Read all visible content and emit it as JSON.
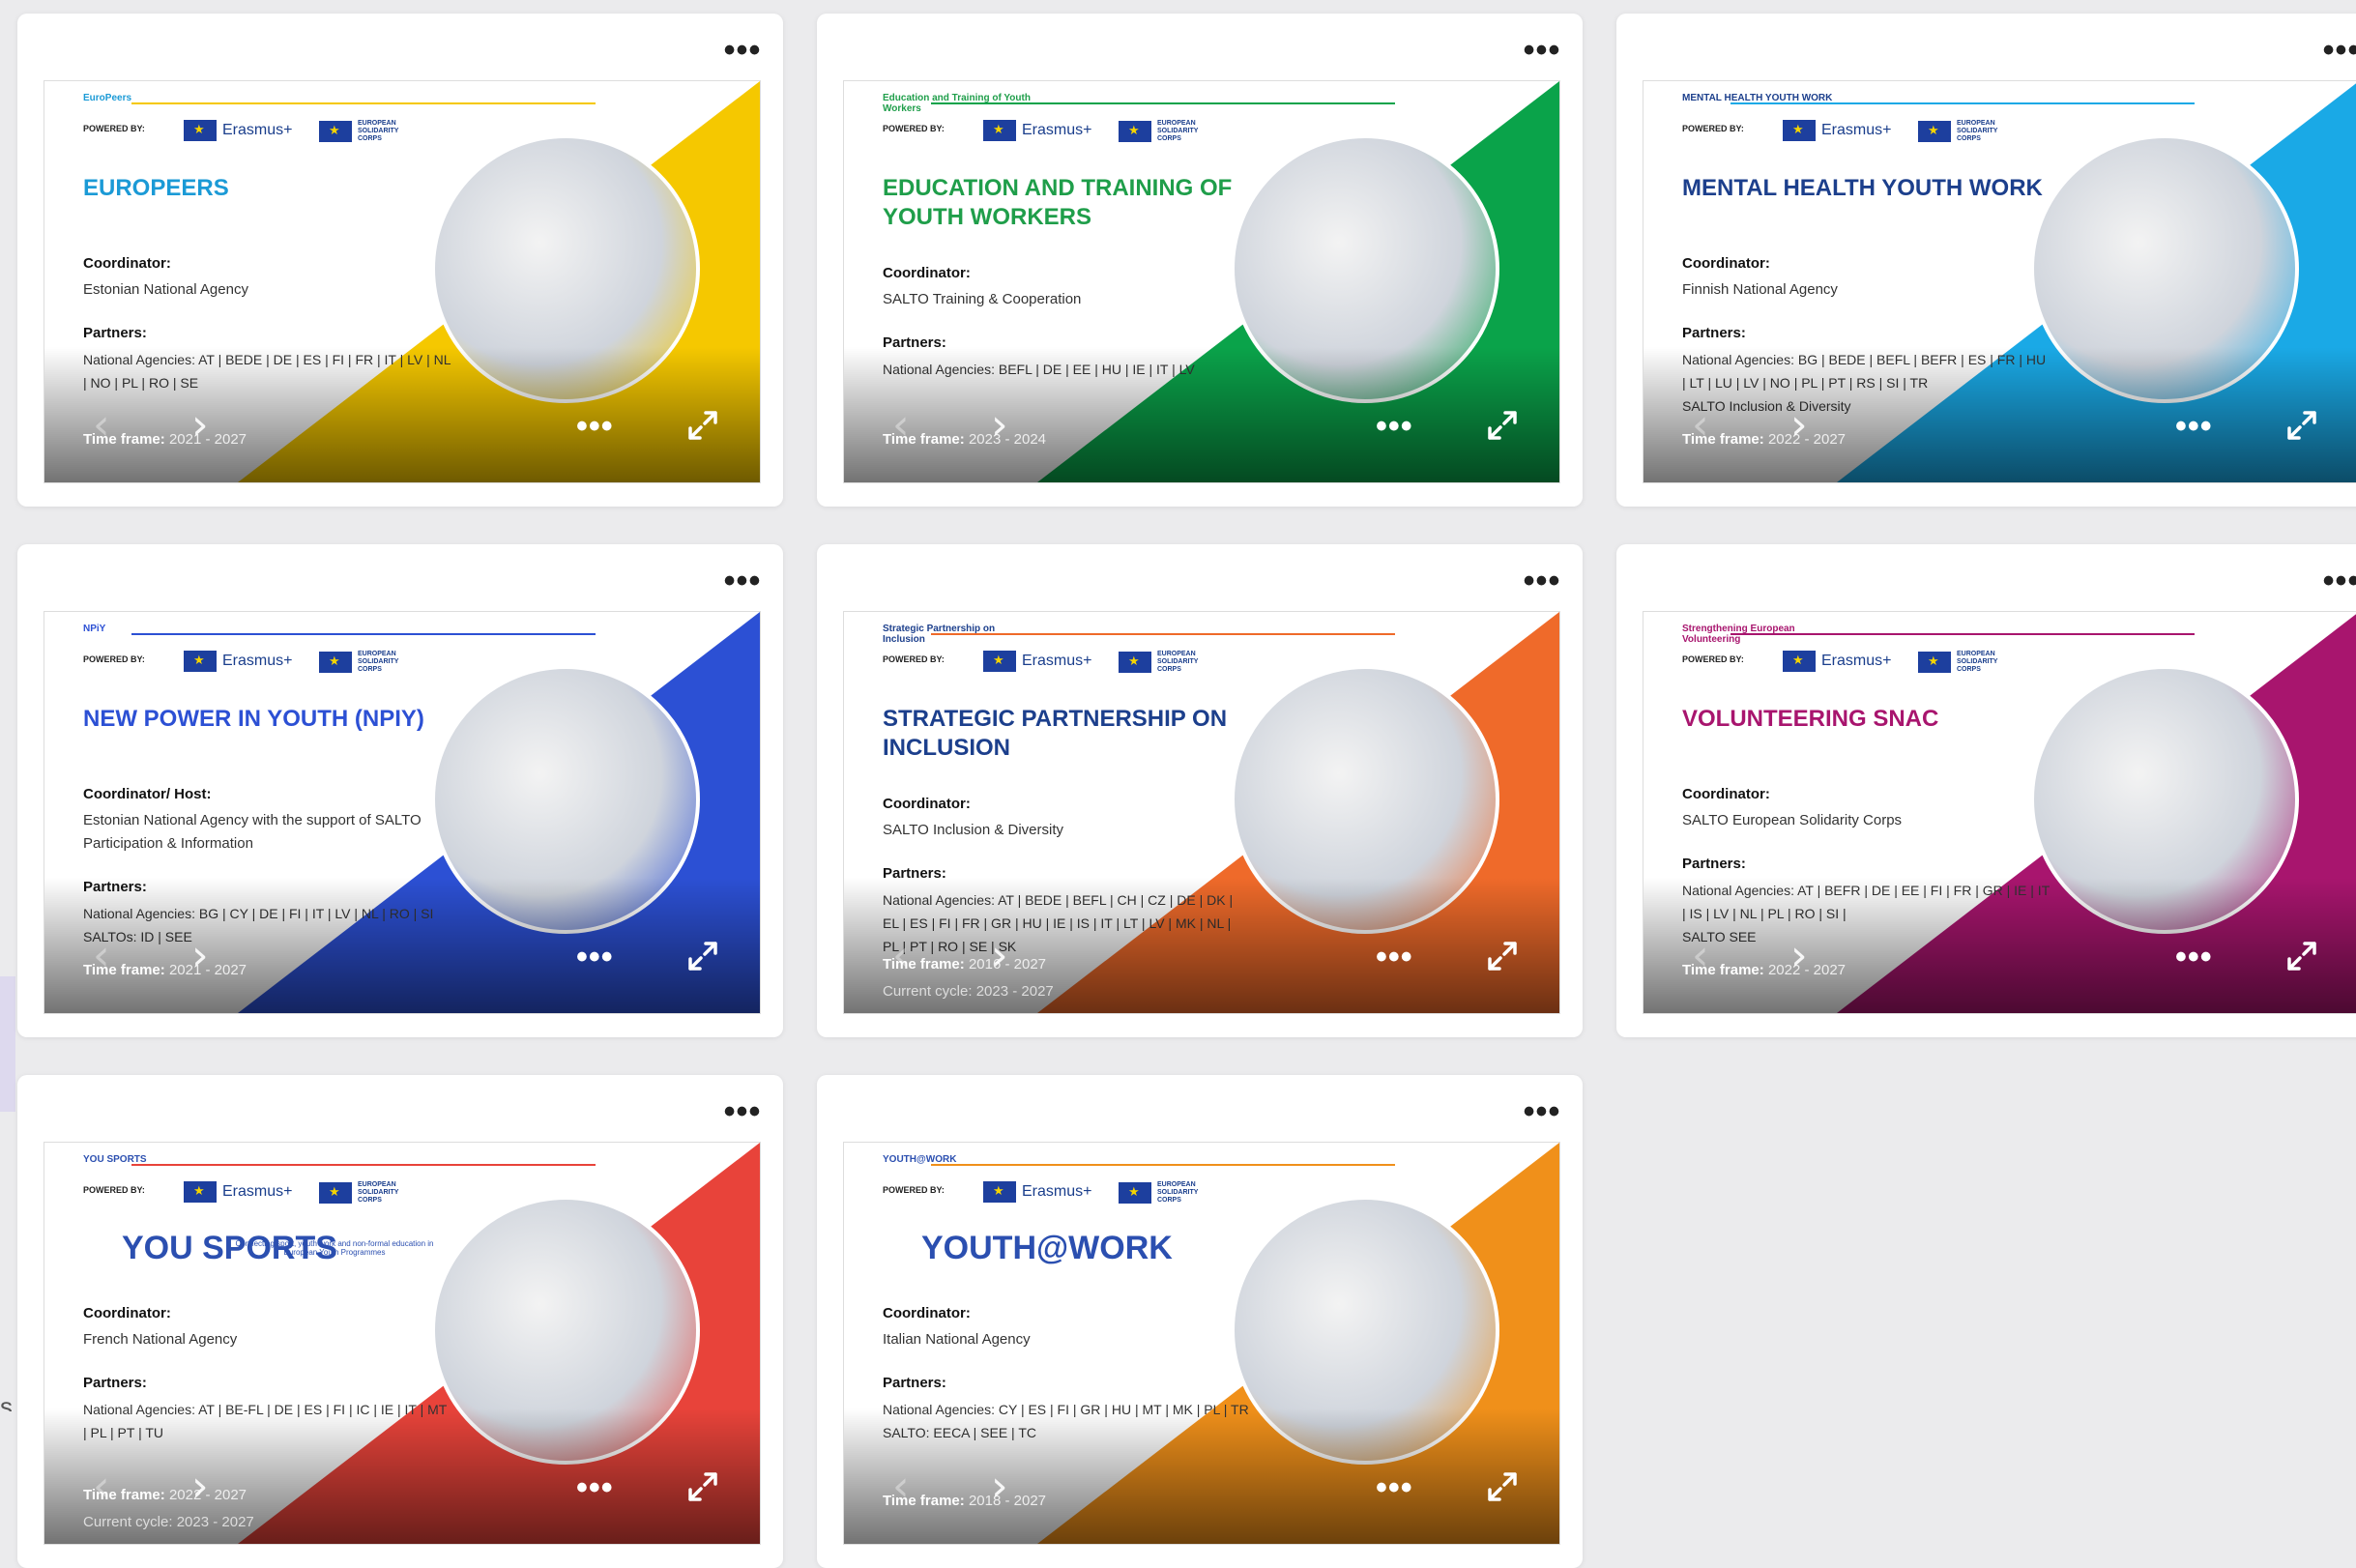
{
  "menu_glyph": "•••",
  "slide_more_glyph": "•••",
  "powered_label": "POWERED BY:",
  "erasmus_label": "Erasmus+",
  "esc_label": "EUROPEAN SOLIDARITY CORPS",
  "coordinator_label": "Coordinator:",
  "partners_label": "Partners:",
  "timeframe_label": "Time frame:",
  "cycle_label": "Current cycle:",
  "cards": [
    {
      "brand": "EuroPeers",
      "title": "EUROPEERS",
      "title_color": "#1b9ad6",
      "accent": "#f5c800",
      "coordinator_label": "Coordinator:",
      "coordinator": "Estonian National Agency",
      "partners": "National Agencies:  AT | BEDE | DE | ES | FI | FR | IT | LV | NL | NO | PL | RO | SE",
      "timeframe": "2021 - 2027",
      "cycle": ""
    },
    {
      "brand": "Education and Training of Youth Workers",
      "title": "EDUCATION AND TRAINING OF YOUTH WORKERS",
      "title_color": "#1f9e4a",
      "accent": "#0aa34a",
      "coordinator_label": "Coordinator:",
      "coordinator": "SALTO Training & Cooperation",
      "partners": "National Agencies: BEFL | DE | EE | HU | IE | IT | LV",
      "timeframe": "2023 - 2024",
      "cycle": ""
    },
    {
      "brand": "MENTAL HEALTH YOUTH WORK",
      "title": "MENTAL HEALTH YOUTH WORK",
      "title_color": "#1c3f8c",
      "accent": "#1aa9e6",
      "coordinator_label": "Coordinator:",
      "coordinator": "Finnish National Agency",
      "partners": "National Agencies: BG | BEDE | BEFL | BEFR | ES | FR | HU | LT | LU | LV | NO | PL | PT | RS | SI | TR\nSALTO Inclusion & Diversity",
      "timeframe": "2022 - 2027",
      "cycle": ""
    },
    {
      "brand": "NPiY",
      "title": "NEW POWER IN YOUTH (NPIY)",
      "title_color": "#2c50d4",
      "accent": "#2c50d4",
      "coordinator_label": "Coordinator/ Host:",
      "coordinator": "Estonian National Agency with the support of SALTO Participation & Information",
      "partners": "National Agencies:  BG | CY | DE | FI | IT | LV | NL | RO | SI\nSALTOs: ID | SEE",
      "timeframe": "2021 - 2027",
      "cycle": ""
    },
    {
      "brand": "Strategic Partnership on Inclusion",
      "title": "STRATEGIC PARTNERSHIP ON INCLUSION",
      "title_color": "#1c3f8c",
      "accent": "#ef6a2a",
      "coordinator_label": "Coordinator:",
      "coordinator": "SALTO Inclusion & Diversity",
      "partners": "National Agencies:  AT | BEDE | BEFL | CH | CZ | DE | DK | EL | ES | FI | FR | GR | HU | IE | IS | IT | LT | LV | MK | NL | PL | PT | RO | SE | SK",
      "timeframe": "2016 - 2027",
      "cycle": "2023 - 2027"
    },
    {
      "brand": "Strengthening European Volunteering",
      "title": "VOLUNTEERING SNAC",
      "title_color": "#a8156e",
      "accent": "#a8156e",
      "coordinator_label": "Coordinator:",
      "coordinator": "SALTO European Solidarity Corps",
      "partners": "National Agencies: AT | BEFR | DE | EE | FI | FR | GR | IE | IT | IS | LV | NL | PL | RO | SI |\nSALTO SEE",
      "timeframe": "2022 - 2027",
      "cycle": ""
    },
    {
      "brand": "YOU SPORTS",
      "title": "YOU SPORTS",
      "title_color": "#2b4fb0",
      "accent": "#e8433a",
      "tagline": "Connecting sport, youth work and non-formal education in European Youth Programmes",
      "coordinator_label": "Coordinator:",
      "coordinator": "French National Agency",
      "partners": "National Agencies:  AT | BE-FL | DE | ES | FI | IC | IE | IT | MT | PL | PT | TU",
      "timeframe": "2022 - 2027",
      "cycle": "2023 - 2027"
    },
    {
      "brand": "YOUTH@WORK",
      "title": "YOUTH@WORK",
      "title_color": "#2b4fb0",
      "accent": "#f0901a",
      "coordinator_label": "Coordinator:",
      "coordinator": "Italian National Agency",
      "partners": "National Agencies:  CY | ES | FI | GR | HU | MT | MK | PL | TR\nSALTO: EECA | SEE | TC",
      "timeframe": "2018 - 2027",
      "cycle": ""
    }
  ]
}
